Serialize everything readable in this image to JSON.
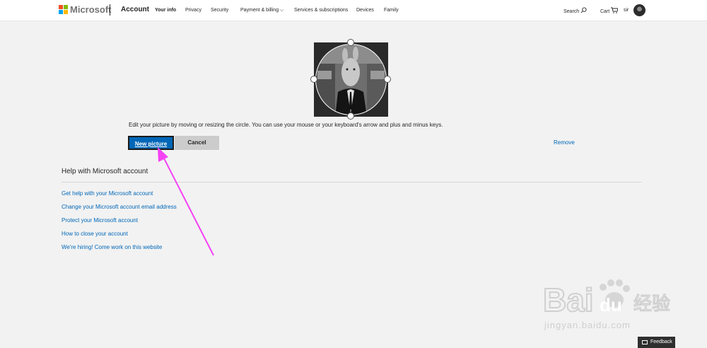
{
  "header": {
    "brand": "Microsoft",
    "section": "Account",
    "nav": [
      {
        "label": "Your info",
        "active": true
      },
      {
        "label": "Privacy"
      },
      {
        "label": "Security"
      },
      {
        "label": "Payment & billing",
        "dropdown": true
      },
      {
        "label": "Services & subscriptions"
      },
      {
        "label": "Devices"
      },
      {
        "label": "Family"
      }
    ],
    "search_label": "Search",
    "cart_label": "Cart",
    "user_name": "sir"
  },
  "editor": {
    "hint": "Edit your picture by moving or resizing the circle. You can use your mouse or your keyboard's arrow and plus and minus keys.",
    "new_picture_label": "New picture",
    "cancel_label": "Cancel",
    "remove_label": "Remove"
  },
  "help": {
    "title": "Help with Microsoft account",
    "links": [
      "Get help with your Microsoft account",
      "Change your Microsoft account email address",
      "Protect your Microsoft account",
      "How to close your account",
      "We're hiring! Come work on this website"
    ]
  },
  "feedback_label": "Feedback",
  "watermark": {
    "logo_text": "Bai du 经验",
    "url": "jingyan.baidu.com"
  },
  "colors": {
    "link": "#0067b8",
    "primary_button": "#0067b8",
    "annotation_arrow": "#f542f5"
  }
}
